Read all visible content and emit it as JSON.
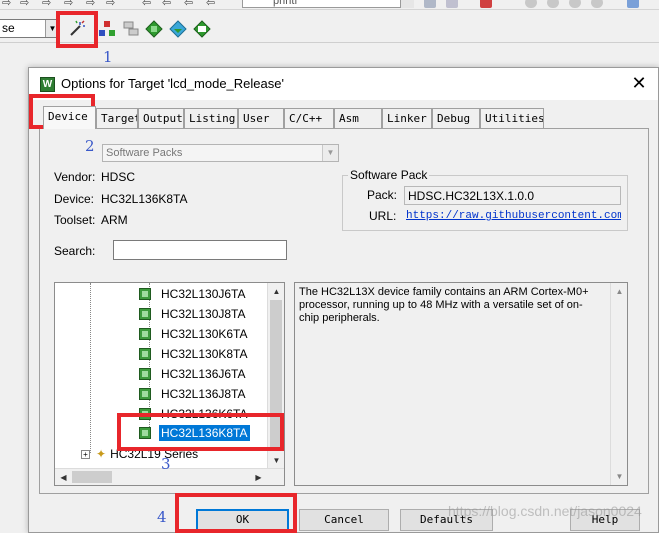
{
  "toolbar": {
    "printf_text": "printf",
    "target_select_value": "se",
    "options_button_tooltip": "Options for Target"
  },
  "annotations": {
    "step1": "1",
    "step2": "2",
    "step3": "3",
    "step4": "4",
    "highlight_color": "#e8262b",
    "number_color": "#3a59c9"
  },
  "dialog": {
    "title": "Options for Target 'lcd_mode_Release'",
    "close_icon": "close-icon",
    "tabs": [
      "Device",
      "Target",
      "Output",
      "Listing",
      "User",
      "C/C++",
      "Asm",
      "Linker",
      "Debug",
      "Utilities"
    ],
    "active_tab": "Device",
    "software_packs_select": "Software Packs",
    "vendor_label": "Vendor:",
    "vendor_value": "HDSC",
    "device_label": "Device:",
    "device_value": "HC32L136K8TA",
    "toolset_label": "Toolset:",
    "toolset_value": "ARM",
    "search_label": "Search:",
    "search_value": "",
    "software_pack": {
      "legend": "Software Pack",
      "pack_label": "Pack:",
      "pack_value": "HDSC.HC32L13X.1.0.0",
      "url_label": "URL:",
      "url_value": "https://raw.githubusercontent.com/hc"
    },
    "device_tree": {
      "items": [
        "HC32L130J6TA",
        "HC32L130J8TA",
        "HC32L130K6TA",
        "HC32L130K8TA",
        "HC32L136J6TA",
        "HC32L136J8TA",
        "HC32L136K6TA",
        "HC32L136K8TA"
      ],
      "selected": "HC32L136K8TA",
      "series_row": "HC32L19 Series"
    },
    "description": "The HC32L13X device family contains an ARM Cortex-M0+ processor, running up to 48 MHz with a versatile set of on-chip peripherals.",
    "buttons": {
      "ok": "OK",
      "cancel": "Cancel",
      "defaults": "Defaults",
      "help": "Help"
    }
  },
  "watermark": "https://blog.csdn.net/jason0024"
}
